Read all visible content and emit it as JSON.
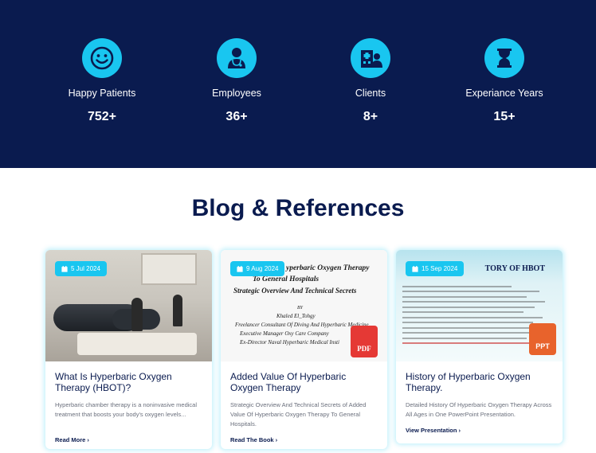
{
  "stats": [
    {
      "icon": "smile-icon",
      "label": "Happy Patients",
      "value": "752",
      "suffix": "+"
    },
    {
      "icon": "doctor-icon",
      "label": "Employees",
      "value": "36",
      "suffix": "+"
    },
    {
      "icon": "hospital-icon",
      "label": "Clients",
      "value": "8",
      "suffix": "+"
    },
    {
      "icon": "hourglass-icon",
      "label": "Experiance Years",
      "value": "15",
      "suffix": "+"
    }
  ],
  "section": {
    "title": "Blog & References"
  },
  "cards": [
    {
      "date": "5 Jul 2024",
      "title": "What Is Hyperbaric Oxygen Therapy (HBOT)?",
      "excerpt": "Hyperbaric chamber therapy is a noninvasive medical treatment that boosts your body's oxygen levels...",
      "link": "Read More ›"
    },
    {
      "date": "9 Aug 2024",
      "title": "Added Value Of Hyperbaric Oxygen Therapy",
      "excerpt": "Strategic Overview And Technical Secrets of Added Value Of Hyperbaric Oxygen Therapy To General Hospitals.",
      "link": "Read The Book ›",
      "doc": {
        "line1": "yperbaric Oxygen Therapy",
        "line2": "To General Hospitals",
        "line3": "Strategic Overview And Technical Secrets",
        "line4": "BY",
        "line5": "Khaled El_Tohgy",
        "line6": "Freelancer Consultant Of Diving And Hyperbaric Medicine",
        "line7": "Executive Manager Oxy Care Company",
        "line8": "Ex-Director Naval Hyperbaric Medical Insti"
      },
      "badge": "PDF"
    },
    {
      "date": "15 Sep 2024",
      "title": "History of Hyperbaric Oxygen Therapy.",
      "excerpt": "Detailed History Of Hyperbaric Oxygen Therapy Across All Ages in One PowerPoint Presentation.",
      "link": "View Presentation ›",
      "slide_title": "TORY OF HBOT",
      "badge": "PPT"
    }
  ],
  "colors": {
    "navy": "#0a1b4f",
    "cyan": "#19c6f0"
  }
}
